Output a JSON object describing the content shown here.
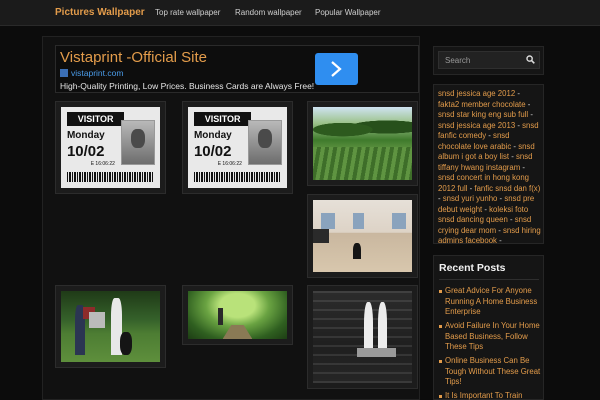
{
  "nav": {
    "brand": "Pictures Wallpaper",
    "links": [
      "Top rate wallpaper",
      "Random wallpaper",
      "Popular Wallpaper"
    ]
  },
  "ad": {
    "title": "Vistaprint -Official Site",
    "url": "vistaprint.com",
    "description": "High-Quality Printing, Low Prices. Business Cards are Always Free!",
    "cta_icon": "chevron-right-icon",
    "cta_color": "#2f8ef0"
  },
  "badge": {
    "header": "VISITOR",
    "day": "Monday",
    "date": "10/02",
    "small": "E 16:06:22"
  },
  "sidebar": {
    "search_placeholder": "Search",
    "tags": [
      "snsd jessica age 2012",
      "fakta2 member chocolate",
      "snsd star king eng sub full",
      "snsd jessica age 2013",
      "snsd fanfic comedy",
      "snsd chocolate love arabic",
      "snsd album i got a boy list",
      "snsd tiffany hwang instagram",
      "snsd concert in hong kong 2012 full",
      "fanfic snsd dan f(x)",
      "snsd yuri yunho",
      "snsd pre debut weight",
      "koleksi foto snsd dancing queen",
      "snsd crying dear mom",
      "snsd hiring admins facebook"
    ],
    "tag_separator": " - ",
    "recent_title": "Recent Posts",
    "recent_posts": [
      "Great Advice For Anyone Running A Home Business Enterprise",
      "Avoid Failure In Your Home Based Business, Follow These Tips",
      "Online Business Can Be Tough Without These Great Tips!",
      "It Is Important To Train"
    ]
  },
  "colors": {
    "accent": "#e39c4b",
    "background": "#0c0c0c",
    "link": "#4a9be8"
  }
}
